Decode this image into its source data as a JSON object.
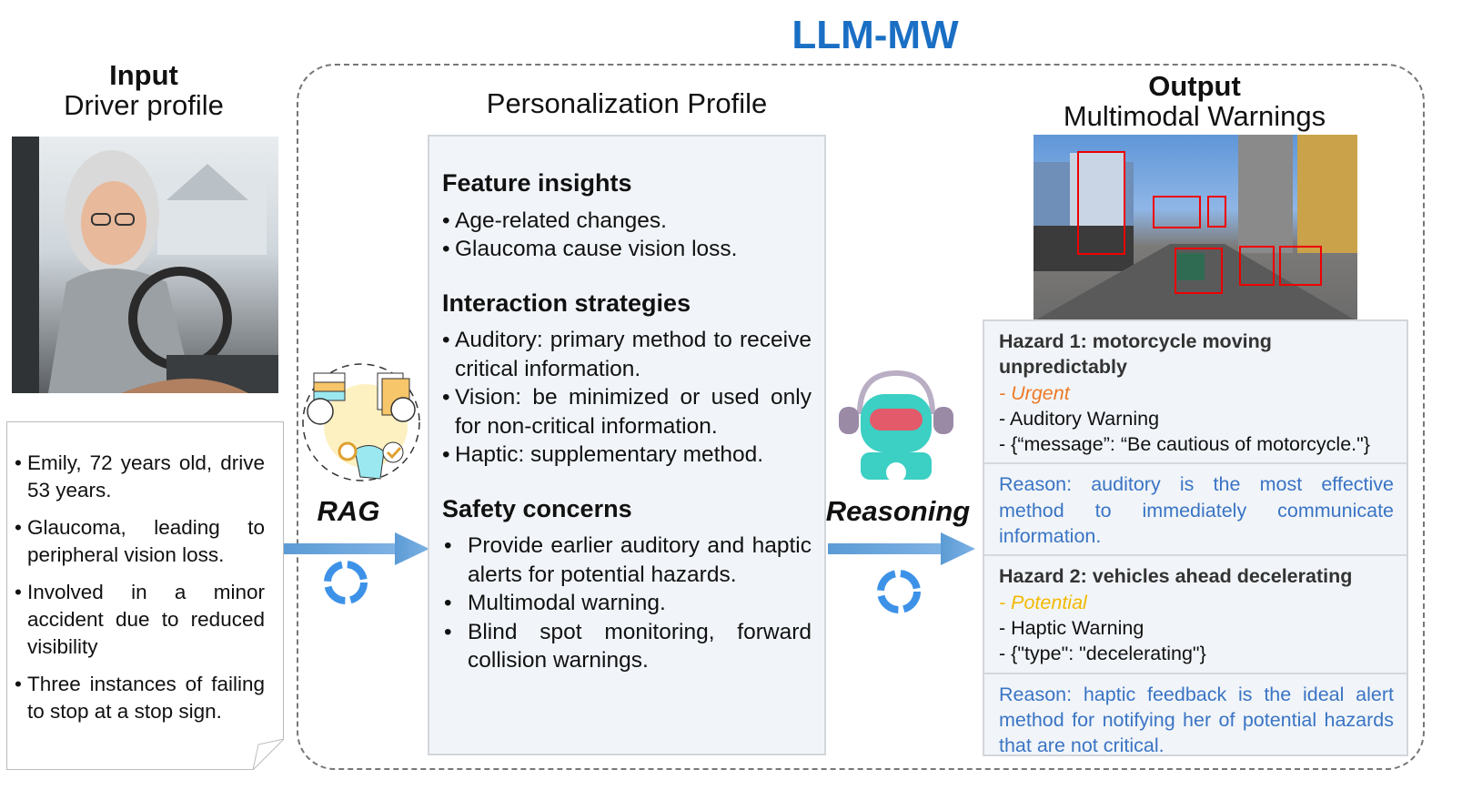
{
  "title": "LLM-MW",
  "input": {
    "heading": "Input",
    "subheading": "Driver profile",
    "notes": [
      "Emily, 72 years old, drive 53 years.",
      "Glaucoma, leading to peripheral vision loss.",
      "Involved in a minor accident due to reduced visibility",
      "Three instances of failing to stop at a stop sign."
    ]
  },
  "rag": {
    "label": "RAG",
    "icon": "rag-knowledge-icon"
  },
  "profile": {
    "heading": "Personalization Profile",
    "sections": [
      {
        "title": "Feature insights",
        "items": [
          "Age-related changes.",
          "Glaucoma cause vision loss."
        ]
      },
      {
        "title": "Interaction strategies",
        "items": [
          "Auditory: primary method to receive critical information.",
          "Vision: be minimized or used only for non-critical information.",
          "Haptic: supplementary method."
        ]
      },
      {
        "title": "Safety concerns",
        "items": [
          "Provide earlier auditory and haptic alerts for potential hazards.",
          "Multimodal warning.",
          "Blind spot monitoring, forward collision warnings."
        ]
      }
    ]
  },
  "reasoning": {
    "label": "Reasoning",
    "icon": "robot-headset-icon"
  },
  "output": {
    "heading": "Output",
    "subheading": "Multimodal Warnings",
    "hazards": [
      {
        "title": "Hazard 1: motorcycle moving unpredictably",
        "level": "- Urgent",
        "mode": "- Auditory Warning",
        "payload": "- {“message”: “Be cautious of motorcycle.\"}",
        "reason": "Reason: auditory is the most effective method to immediately communicate information."
      },
      {
        "title": "Hazard 2: vehicles ahead decelerating",
        "level": "- Potential",
        "mode": "- Haptic Warning",
        "payload": "- {\"type\": \"decelerating\"}",
        "reason": "Reason: haptic feedback is the ideal alert method for notifying her of potential hazards that are not critical."
      }
    ]
  },
  "colors": {
    "title": "#1a6fc4",
    "urgent": "#ee7a26",
    "potential": "#f3b800",
    "reason": "#3a74c4",
    "arrow": "#5b9bd5",
    "detection_box": "#ee0000"
  }
}
